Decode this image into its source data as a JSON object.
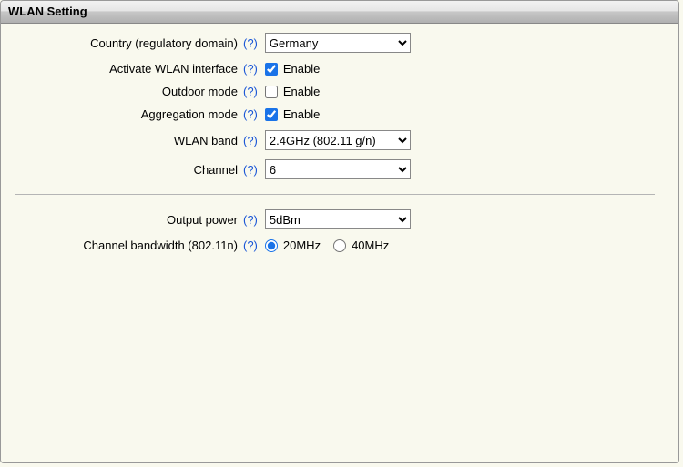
{
  "panel": {
    "title": "WLAN Setting"
  },
  "help_marker": "(?)",
  "labels": {
    "country": "Country (regulatory domain)",
    "activate": "Activate WLAN interface",
    "outdoor": "Outdoor mode",
    "aggregation": "Aggregation mode",
    "band": "WLAN band",
    "channel": "Channel",
    "power": "Output power",
    "chanbw": "Channel bandwidth (802.11n)"
  },
  "values": {
    "country": "Germany",
    "activate_enabled": true,
    "outdoor_enabled": false,
    "aggregation_enabled": true,
    "band": "2.4GHz (802.11 g/n)",
    "channel": "6",
    "power": "5dBm",
    "chanbw": "20MHz"
  },
  "options": {
    "country": [
      "Germany"
    ],
    "band": [
      "2.4GHz (802.11 g/n)"
    ],
    "channel": [
      "6"
    ],
    "power": [
      "5dBm"
    ],
    "chanbw": [
      "20MHz",
      "40MHz"
    ]
  },
  "text": {
    "enable": "Enable"
  }
}
